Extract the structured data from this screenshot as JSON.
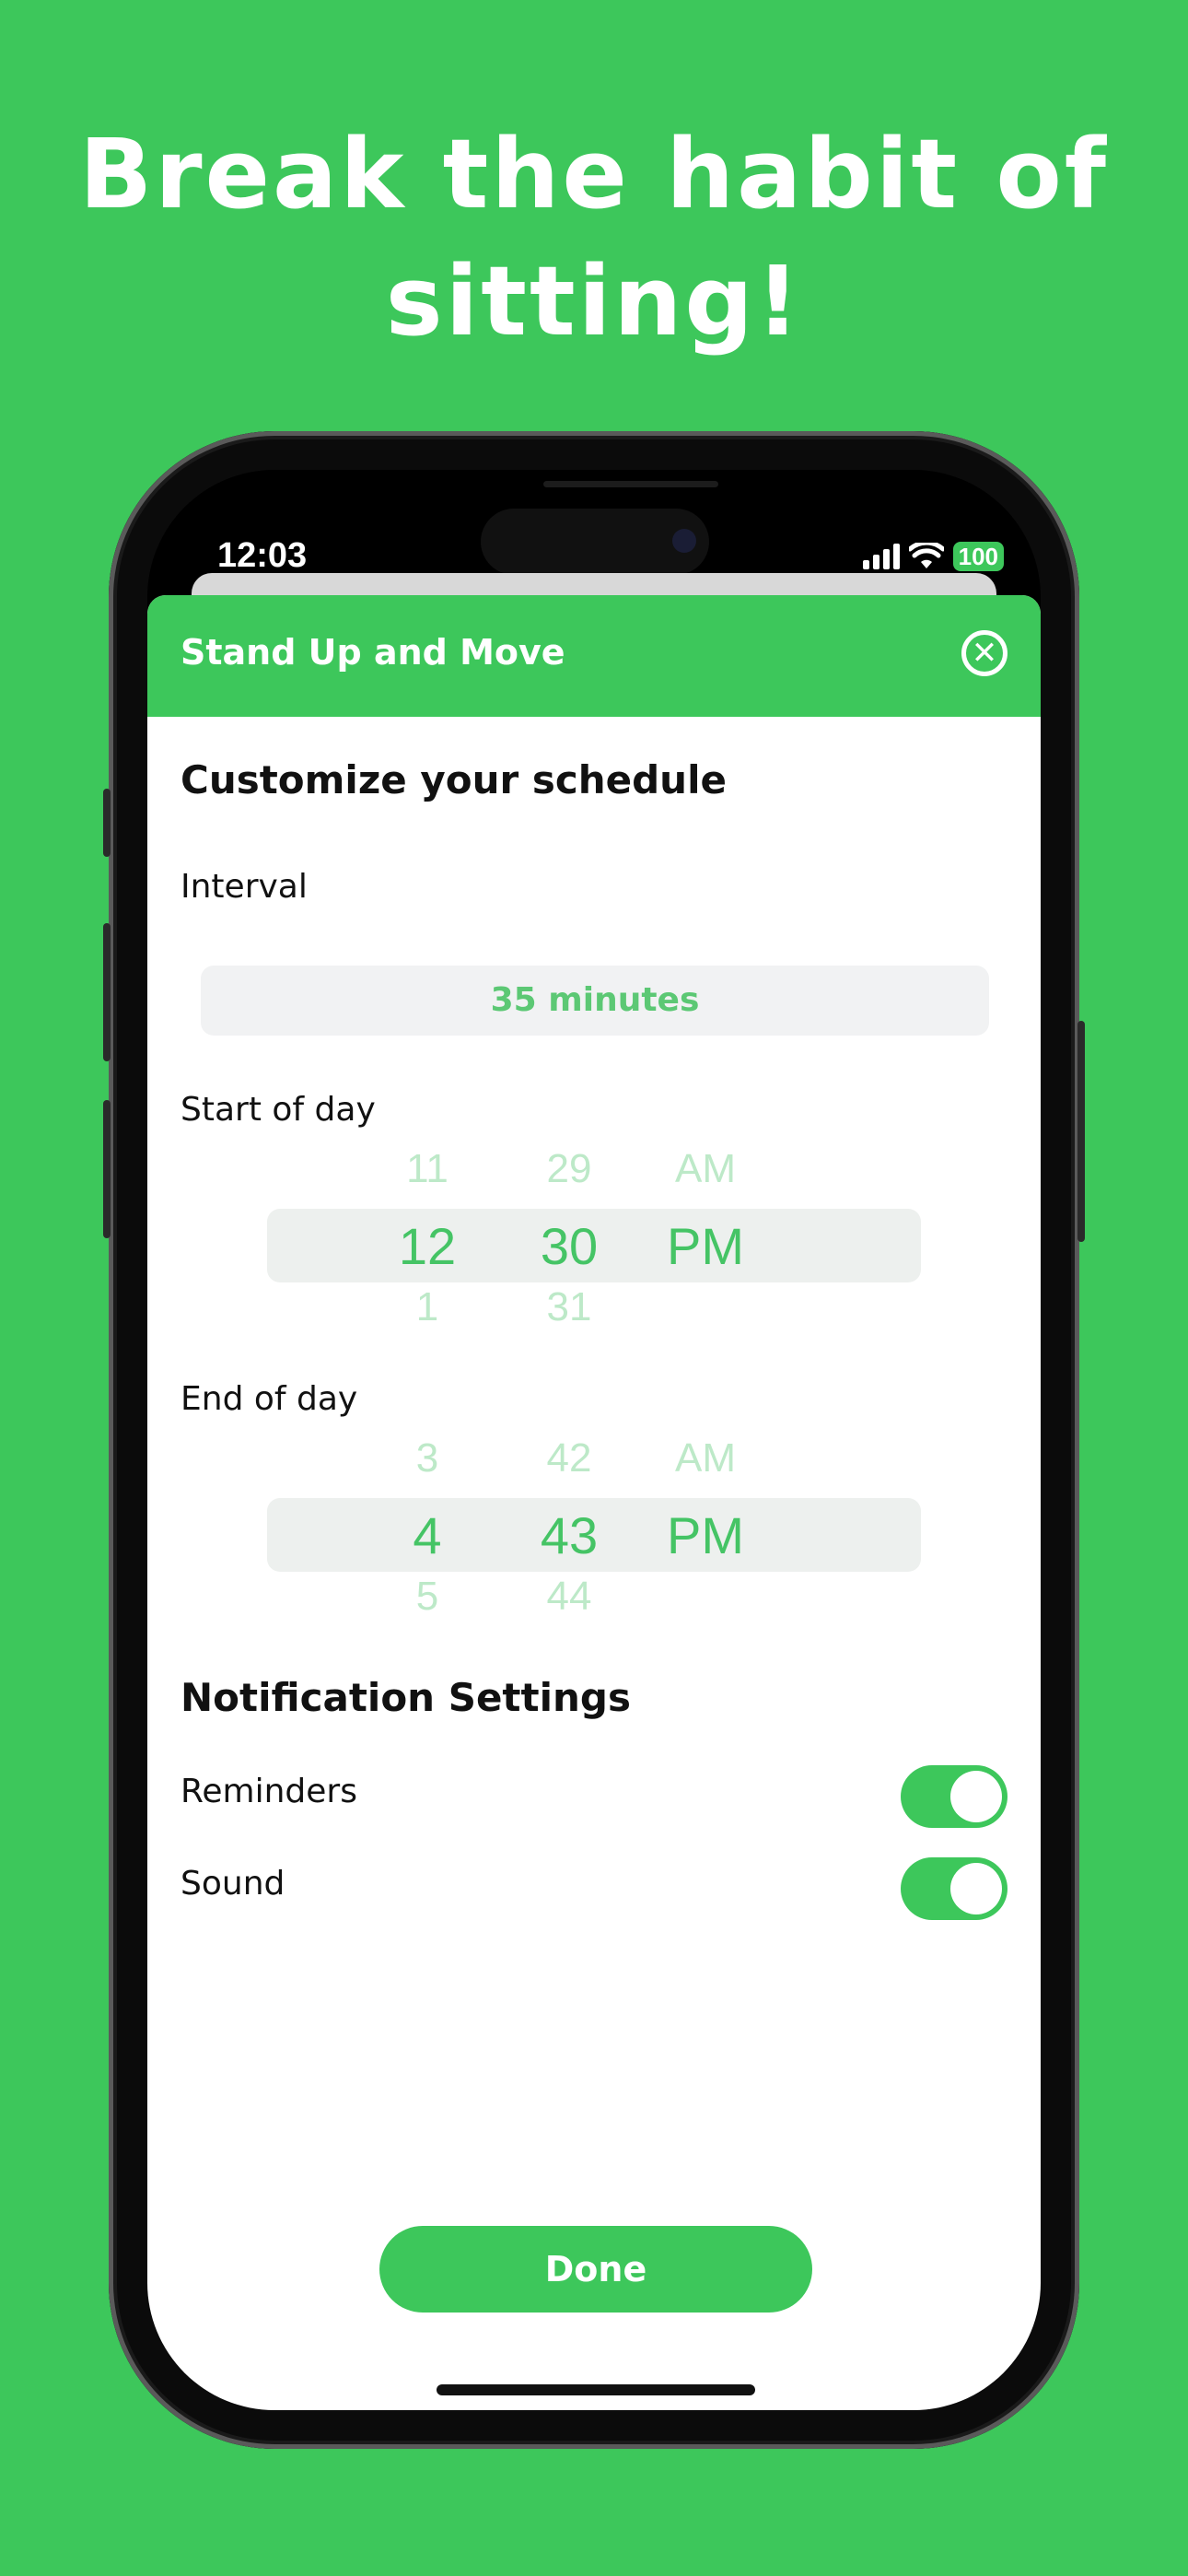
{
  "headline": {
    "line1": "Break the habit of",
    "line2": "sitting!"
  },
  "status_bar": {
    "time": "12:03",
    "battery": "100"
  },
  "sheet": {
    "title": "Stand Up and Move",
    "section_schedule": "Customize your schedule",
    "interval_label": "Interval",
    "interval_value": "35 minutes",
    "start_label": "Start of day",
    "start_picker": {
      "above": [
        "11",
        "29",
        "AM"
      ],
      "selected": [
        "12",
        "30",
        "PM"
      ],
      "below": [
        "1",
        "31",
        ""
      ]
    },
    "end_label": "End of day",
    "end_picker": {
      "above": [
        "3",
        "42",
        "AM"
      ],
      "selected": [
        "4",
        "43",
        "PM"
      ],
      "below": [
        "5",
        "44",
        ""
      ]
    },
    "section_notifications": "Notification Settings",
    "reminders_label": "Reminders",
    "reminders_on": true,
    "sound_label": "Sound",
    "sound_on": true,
    "done_label": "Done"
  },
  "colors": {
    "brand_green": "#3dc75b",
    "picker_text": "#45c465"
  }
}
